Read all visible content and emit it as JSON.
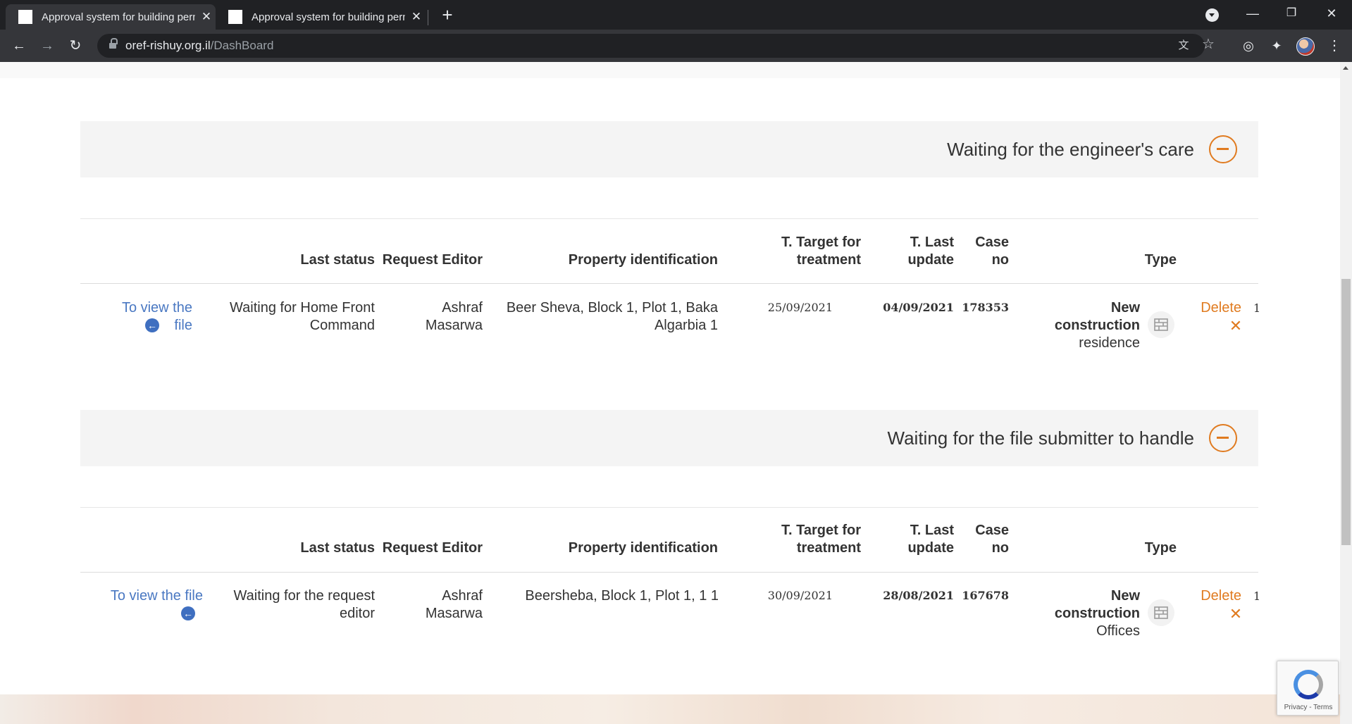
{
  "browser": {
    "tabs": [
      {
        "title": "Approval system for building permits",
        "active": true
      },
      {
        "title": "Approval system for building permits",
        "active": false
      }
    ],
    "url_domain": "oref-rishuy.org.il",
    "url_path": "/DashBoard"
  },
  "colors": {
    "accent_orange": "#e07b20",
    "link_blue": "#4a78c2",
    "section_bg": "#f4f4f4"
  },
  "table_headers": {
    "last_status": "Last status",
    "request_editor": "Request Editor",
    "property_identification": "Property identification",
    "target_for_treatment": "T. Target for treatment",
    "last_update": "T. Last update",
    "case_no": "Case no",
    "type": "Type"
  },
  "sections": [
    {
      "title": "Waiting for the engineer's care",
      "row": {
        "view_link": "To view the file",
        "last_status": "Waiting for Home Front Command",
        "request_editor": "Ashraf Masarwa",
        "property": "Beer Sheva, Block 1, Plot 1, Baka Algarbia 1",
        "target_date": "25/09/2021",
        "last_update": "04/09/2021",
        "case_no": "178353",
        "type_main": "New construction",
        "type_sub": "residence",
        "delete_label": "Delete",
        "row_number": "1"
      }
    },
    {
      "title": "Waiting for the file submitter to handle",
      "row": {
        "view_link": "To view the file",
        "last_status": "Waiting for the request editor",
        "request_editor": "Ashraf Masarwa",
        "property": "Beersheba, Block 1, Plot 1, 1 1",
        "target_date": "30/09/2021",
        "last_update": "28/08/2021",
        "case_no": "167678",
        "type_main": "New construction",
        "type_sub": "Offices",
        "delete_label": "Delete",
        "row_number": "1"
      }
    }
  ],
  "recaptcha": {
    "footer": "Privacy - Terms"
  }
}
